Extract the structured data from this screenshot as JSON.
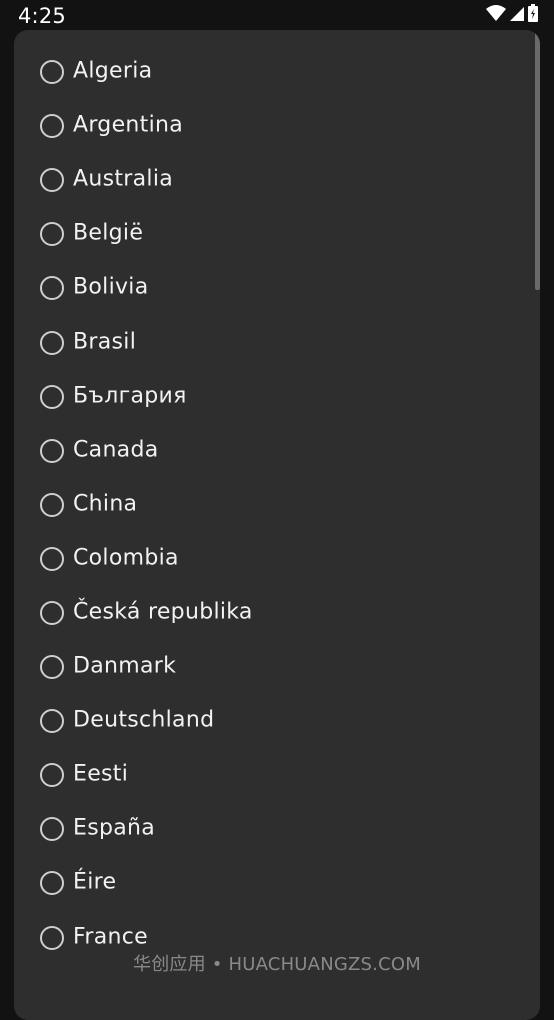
{
  "status_bar": {
    "time": "4:25",
    "icons": [
      "wifi-icon",
      "cell-signal-icon",
      "battery-icon"
    ]
  },
  "country_list": {
    "items": [
      {
        "label": "Algeria",
        "selected": false
      },
      {
        "label": "Argentina",
        "selected": false
      },
      {
        "label": "Australia",
        "selected": false
      },
      {
        "label": "België",
        "selected": false
      },
      {
        "label": "Bolivia",
        "selected": false
      },
      {
        "label": "Brasil",
        "selected": false
      },
      {
        "label": "България",
        "selected": false
      },
      {
        "label": "Canada",
        "selected": false
      },
      {
        "label": "China",
        "selected": false
      },
      {
        "label": "Colombia",
        "selected": false
      },
      {
        "label": "Česká republika",
        "selected": false
      },
      {
        "label": "Danmark",
        "selected": false
      },
      {
        "label": "Deutschland",
        "selected": false
      },
      {
        "label": "Eesti",
        "selected": false
      },
      {
        "label": "España",
        "selected": false
      },
      {
        "label": "Éire",
        "selected": false
      },
      {
        "label": "France",
        "selected": false
      }
    ]
  },
  "watermark": "华创应用 • HUACHUANGZS.COM",
  "colors": {
    "background": "#121212",
    "dialog": "#2e2e2e",
    "text": "#f2f2f2",
    "radio_border": "#cfcfcf",
    "scrollbar": "#6a6a6a"
  }
}
